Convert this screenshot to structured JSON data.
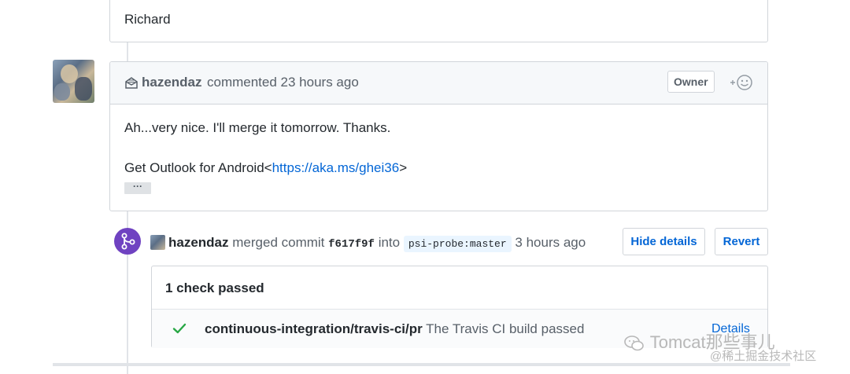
{
  "previous_comment": {
    "text": "Richard"
  },
  "comment": {
    "author": "hazendaz",
    "action": "commented 23 hours ago",
    "badge": "Owner",
    "line1": "Ah...very nice.  I'll merge it tomorrow.  Thanks.",
    "line2_prefix": "Get Outlook for Android<",
    "link": "https://aka.ms/ghei36",
    "line2_suffix": ">",
    "ellipsis": "···"
  },
  "merge_event": {
    "author": "hazendaz",
    "verb": "merged commit",
    "sha": "f617f9f",
    "into": "into",
    "branch": "psi-probe:master",
    "time": "3 hours ago",
    "hide_details_label": "Hide details",
    "revert_label": "Revert"
  },
  "checks": {
    "summary": "1 check passed",
    "items": [
      {
        "context": "continuous-integration/travis-ci/pr",
        "description": "The Travis CI build passed",
        "details_label": "Details"
      }
    ]
  },
  "watermark": {
    "line1": "Tomcat那些事儿",
    "line2": "@稀土掘金技术社区"
  },
  "colors": {
    "link": "#0366d6",
    "merged_purple": "#6f42c1",
    "success_green": "#28a745",
    "border": "#d1d5da"
  }
}
